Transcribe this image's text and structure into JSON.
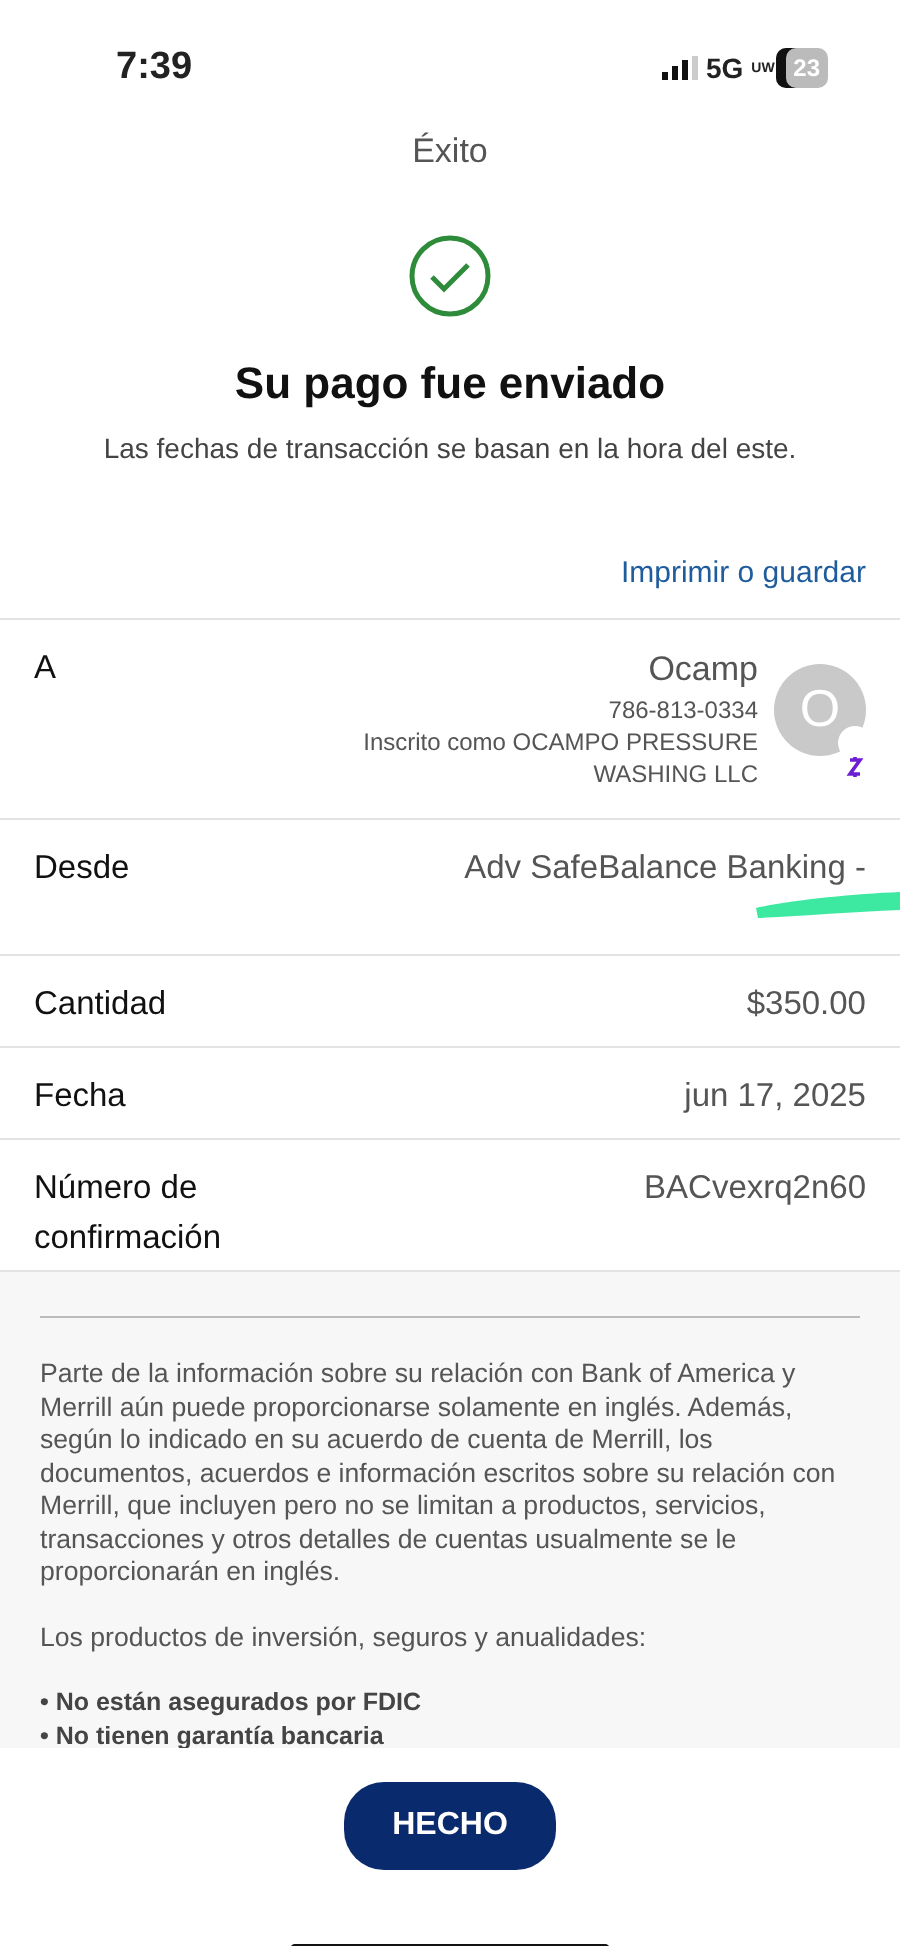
{
  "status_bar": {
    "time": "7:39",
    "network": "5G",
    "network_sub": "UW",
    "battery": "23"
  },
  "header": {
    "title": "Éxito"
  },
  "confirmation": {
    "heading": "Su pago fue enviado",
    "subtitle": "Las fechas de transacción se basan en la hora del este.",
    "print_link": "Imprimir o guardar"
  },
  "recipient": {
    "label": "A",
    "name": "Ocamp",
    "phone": "786-813-0334",
    "enrolled": "Inscrito como OCAMPO PRESSURE WASHING LLC",
    "avatar_initial": "O"
  },
  "details": [
    {
      "label": "Desde",
      "value": "Adv SafeBalance Banking -",
      "redacted": true
    },
    {
      "label": "Cantidad",
      "value": "$350.00",
      "redacted": false
    },
    {
      "label": "Fecha",
      "value": "jun 17, 2025",
      "redacted": false
    },
    {
      "label": "Número de confirmación",
      "value": "BACvexrq2n60",
      "redacted": false
    }
  ],
  "disclosure": {
    "paragraphs": [
      "Parte de la información sobre su relación con Bank of America y Merrill aún puede proporcionarse solamente en inglés. Además, según lo indicado en su acuerdo de cuenta de Merrill, los documentos, acuerdos e información escritos sobre su relación con Merrill, que incluyen pero no se limitan a productos, servicios, transacciones y otros detalles de cuentas usualmente se le proporcionarán en inglés.",
      "Los productos de inversión, seguros y anualidades:"
    ],
    "bullets": [
      "• No están asegurados por FDIC",
      "• No tienen garantía bancaria"
    ]
  },
  "done_button": "HECHO"
}
